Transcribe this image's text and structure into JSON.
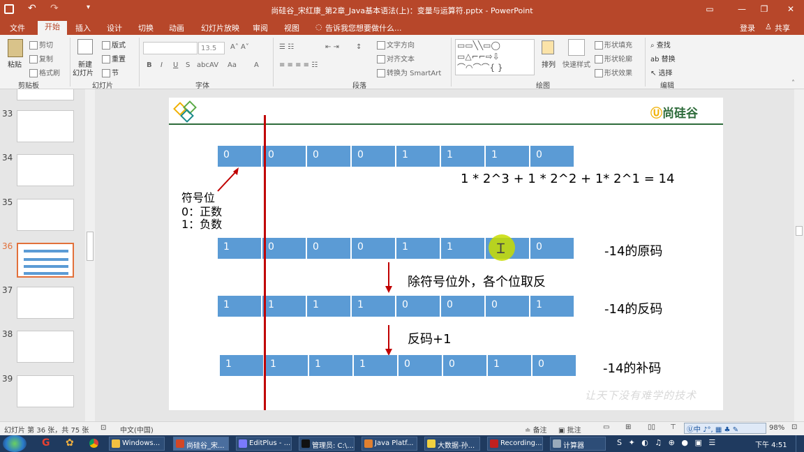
{
  "window": {
    "title": "尚硅谷_宋红康_第2章_Java基本语法(上)：变量与运算符.pptx - PowerPoint"
  },
  "tabs": [
    "文件",
    "开始",
    "插入",
    "设计",
    "切换",
    "动画",
    "幻灯片放映",
    "审阅",
    "视图"
  ],
  "tell_me": "告诉我您想要做什么...",
  "account": {
    "login": "登录",
    "share": "共享"
  },
  "ribbon": {
    "clipboard": {
      "paste": "粘贴",
      "cut": "剪切",
      "copy": "复制",
      "format_painter": "格式刷",
      "group": "剪贴板"
    },
    "slides": {
      "new_slide_1": "新建",
      "new_slide_2": "幻灯片",
      "layout": "版式",
      "reset": "重置",
      "section": "节",
      "group": "幻灯片"
    },
    "font": {
      "size": "13.5",
      "group": "字体"
    },
    "paragraph": {
      "text_direction": "文字方向",
      "align_text": "对齐文本",
      "smartart": "转换为 SmartArt",
      "group": "段落"
    },
    "drawing": {
      "arrange": "排列",
      "quick_styles": "快速样式",
      "shape_fill": "形状填充",
      "shape_outline": "形状轮廓",
      "shape_effects": "形状效果",
      "group": "绘图"
    },
    "editing": {
      "find": "查找",
      "replace": "替换",
      "select": "选择",
      "group": "编辑"
    }
  },
  "thumbnails": [
    {
      "num": "33"
    },
    {
      "num": "34"
    },
    {
      "num": "35"
    },
    {
      "num": "36",
      "selected": true
    },
    {
      "num": "37"
    },
    {
      "num": "38"
    },
    {
      "num": "39"
    }
  ],
  "slide": {
    "logo": "尚硅谷",
    "row1": [
      "0",
      "0",
      "0",
      "0",
      "1",
      "1",
      "1",
      "0"
    ],
    "equation": "1 * 2^3 + 1 * 2^2 + 1* 2^1 = 14",
    "sign_label_1": "符号位",
    "sign_label_2": "0：正数",
    "sign_label_3": "1：负数",
    "row2": [
      "1",
      "0",
      "0",
      "0",
      "1",
      "1",
      "",
      "0"
    ],
    "row2_label": "-14的原码",
    "step1": "除符号位外，各个位取反",
    "row3": [
      "1",
      "1",
      "1",
      "1",
      "0",
      "0",
      "0",
      "1"
    ],
    "row3_label": "-14的反码",
    "step2": "反码+1",
    "row4": [
      "1",
      "1",
      "1",
      "1",
      "0",
      "0",
      "1",
      "0"
    ],
    "row4_label": "-14的补码",
    "watermark": "让天下没有难学的技术",
    "accent": "#5b9bd5",
    "line_color": "#c00000"
  },
  "status": {
    "slide_info": "幻灯片 第 36 张，共 75 张",
    "lang": "中文(中国)",
    "notes": "备注",
    "comments": "批注",
    "zoom": "98%"
  },
  "taskbar": {
    "items": [
      "Windows...",
      "尚硅谷_宋...",
      "EditPlus - ...",
      "管理员: C:\\...",
      "Java Platf...",
      "大数据-孙...",
      "Recording...",
      "计算器"
    ],
    "clock": "下午 4:51"
  }
}
